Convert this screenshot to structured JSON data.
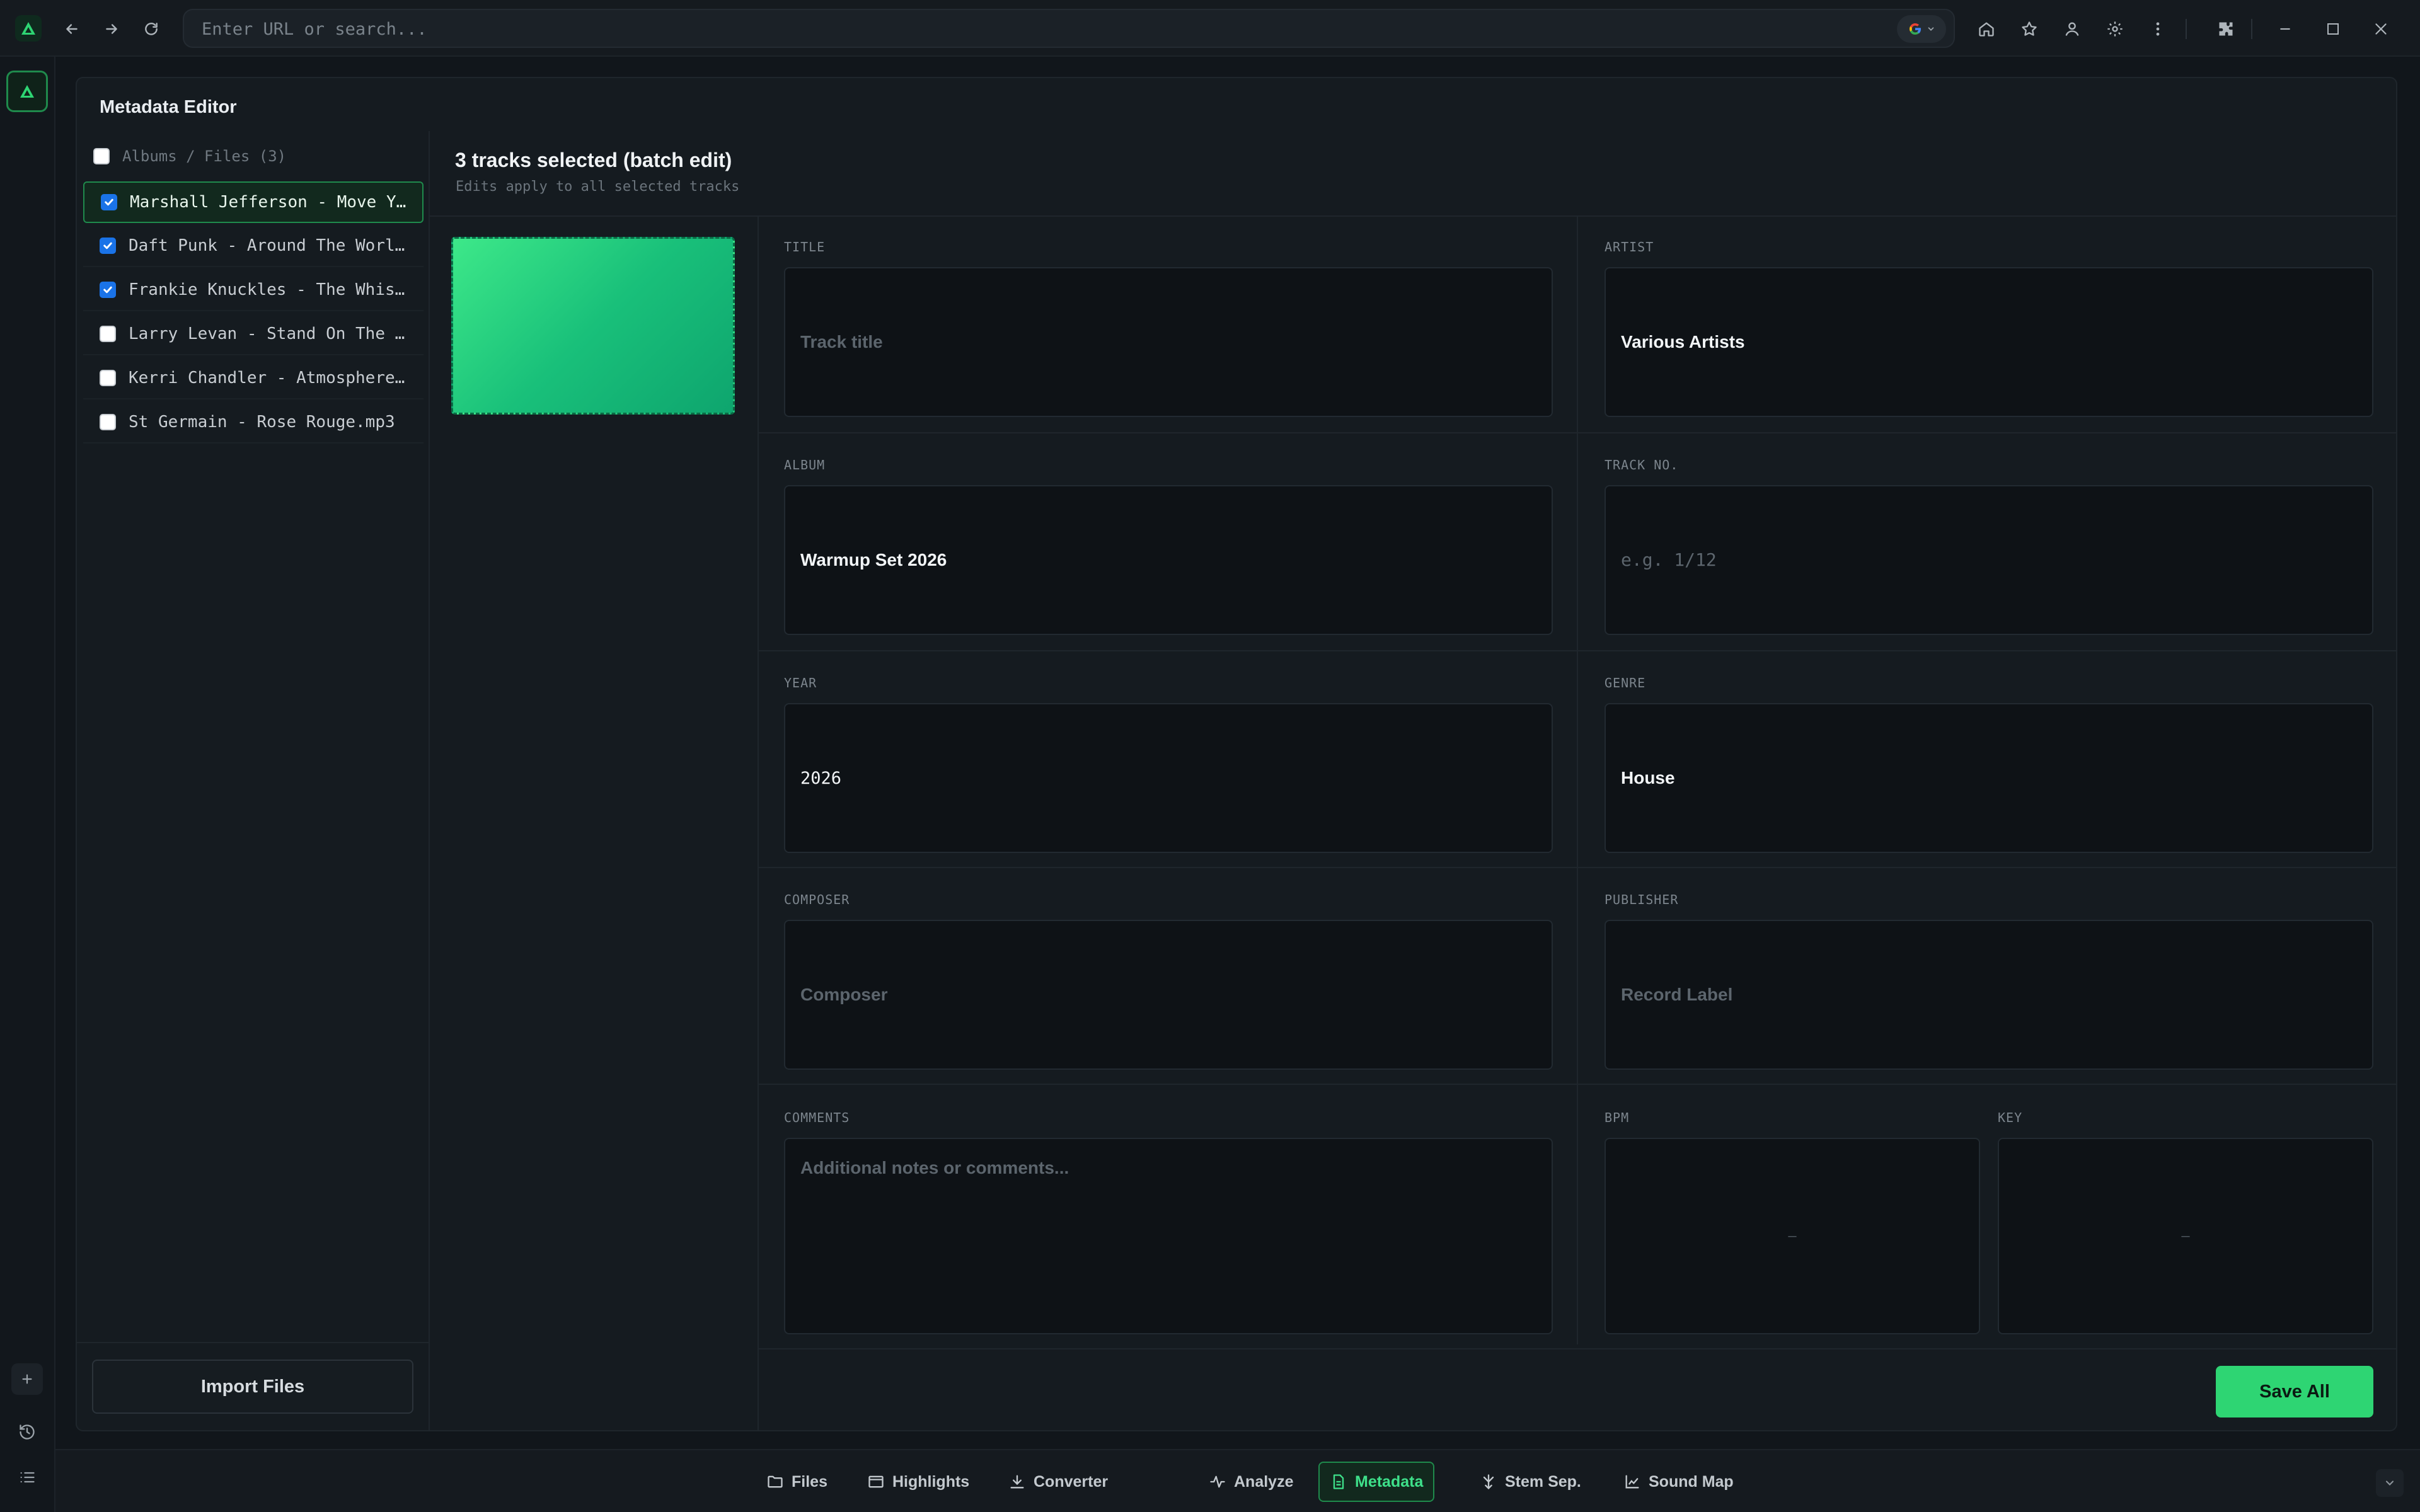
{
  "browser": {
    "url_placeholder": "Enter URL or search...",
    "search_engine_icon": "google-icon"
  },
  "panel": {
    "title": "Metadata Editor"
  },
  "files": {
    "header": "Albums / Files (3)",
    "items": [
      {
        "label": "Marshall Jefferson - Move Y...",
        "checked": true,
        "active": true
      },
      {
        "label": "Daft Punk - Around The Worl...",
        "checked": true,
        "active": false
      },
      {
        "label": "Frankie Knuckles - The Whis...",
        "checked": true,
        "active": false
      },
      {
        "label": "Larry Levan - Stand On The ...",
        "checked": false,
        "active": false
      },
      {
        "label": "Kerri Chandler - Atmosphere...",
        "checked": false,
        "active": false
      },
      {
        "label": "St Germain - Rose Rouge.mp3",
        "checked": false,
        "active": false
      }
    ],
    "import_label": "Import Files"
  },
  "editor": {
    "batch_title": "3 tracks selected (batch edit)",
    "batch_subtitle": "Edits apply to all selected tracks",
    "fields": {
      "title": {
        "label": "TITLE",
        "value": "",
        "placeholder": "Track title"
      },
      "artist": {
        "label": "ARTIST",
        "value": "Various Artists",
        "placeholder": ""
      },
      "album": {
        "label": "ALBUM",
        "value": "Warmup Set 2026",
        "placeholder": ""
      },
      "track_no": {
        "label": "TRACK NO.",
        "value": "",
        "placeholder": "e.g. 1/12"
      },
      "year": {
        "label": "YEAR",
        "value": "2026",
        "placeholder": ""
      },
      "genre": {
        "label": "GENRE",
        "value": "House",
        "placeholder": ""
      },
      "composer": {
        "label": "COMPOSER",
        "value": "",
        "placeholder": "Composer"
      },
      "publisher": {
        "label": "PUBLISHER",
        "value": "",
        "placeholder": "Record Label"
      },
      "comments": {
        "label": "COMMENTS",
        "value": "",
        "placeholder": "Additional notes or comments..."
      },
      "bpm": {
        "label": "BPM",
        "value": "—"
      },
      "key": {
        "label": "KEY",
        "value": "—"
      }
    },
    "save_label": "Save All",
    "art_colors": [
      "#3de889",
      "#0ea56e"
    ]
  },
  "tabs": [
    {
      "label": "Files",
      "icon": "folder-icon",
      "active": false
    },
    {
      "label": "Highlights",
      "icon": "film-icon",
      "active": false
    },
    {
      "label": "Converter",
      "icon": "download-icon",
      "active": false
    },
    {
      "label": "Analyze",
      "icon": "activity-icon",
      "active": false
    },
    {
      "label": "Metadata",
      "icon": "document-icon",
      "active": true
    },
    {
      "label": "Stem Sep.",
      "icon": "split-icon",
      "active": false
    },
    {
      "label": "Sound Map",
      "icon": "chart-icon",
      "active": false
    }
  ],
  "colors": {
    "accent": "#2ed573",
    "background": "#11161b",
    "panel": "#151b20"
  }
}
